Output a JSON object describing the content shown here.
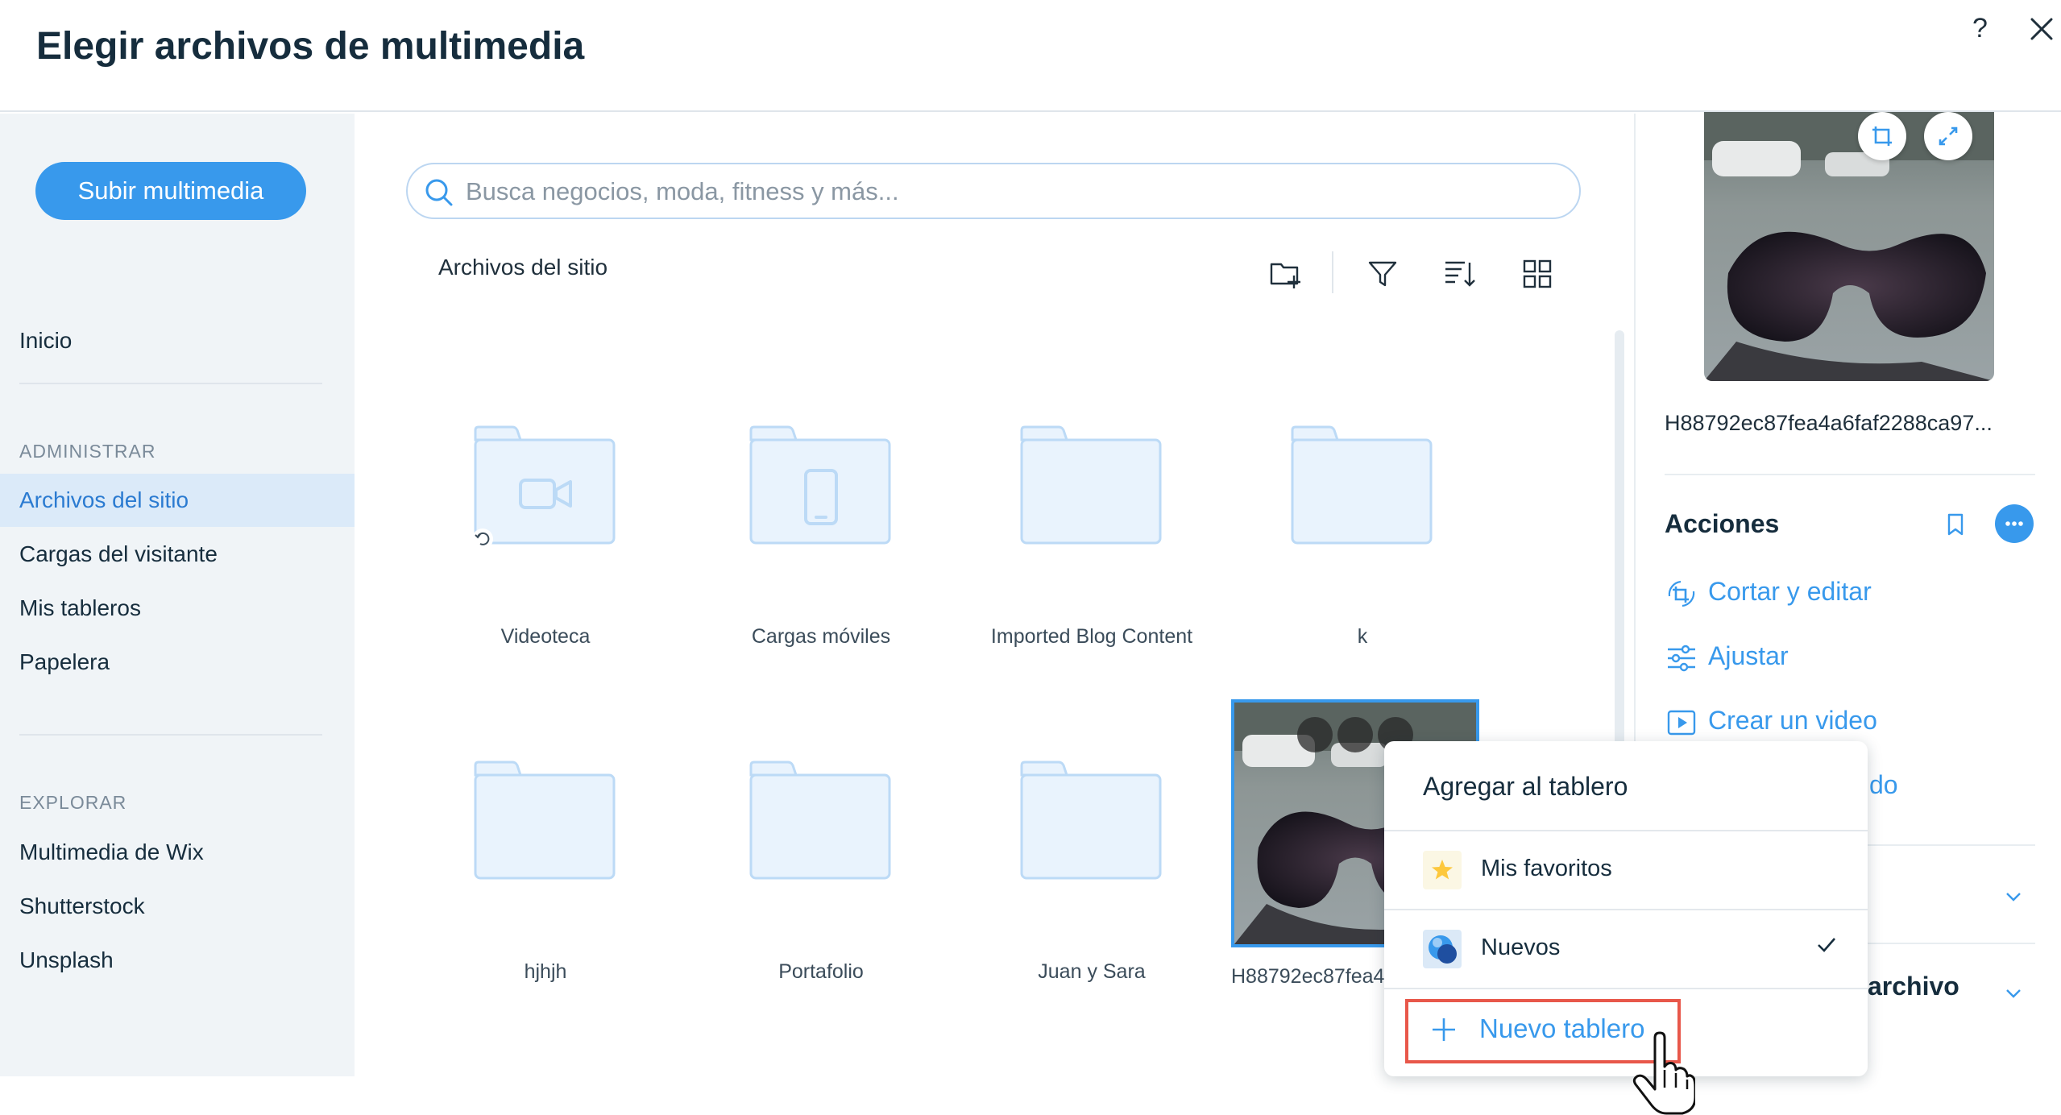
{
  "header": {
    "title": "Elegir archivos de multimedia",
    "help_label": "?",
    "close_icon": "close-icon"
  },
  "sidebar": {
    "upload_label": "Subir multimedia",
    "home_label": "Inicio",
    "section_manage": "ADMINISTRAR",
    "manage_items": [
      "Archivos del sitio",
      "Cargas del visitante",
      "Mis tableros",
      "Papelera"
    ],
    "active_item": "Archivos del sitio",
    "section_explore": "EXPLORAR",
    "explore_items": [
      "Multimedia de Wix",
      "Shutterstock",
      "Unsplash"
    ]
  },
  "main": {
    "search_placeholder": "Busca negocios, moda, fitness y más...",
    "breadcrumb": "Archivos del sitio",
    "toolbar_icons": [
      "new-folder-icon",
      "filter-icon",
      "sort-icon",
      "grid-view-icon"
    ],
    "folders": [
      {
        "label": "Videoteca",
        "icon": "video-camera-icon"
      },
      {
        "label": "Cargas móviles",
        "icon": "mobile-phone-icon"
      },
      {
        "label": "Imported Blog Content",
        "icon": ""
      },
      {
        "label": "k",
        "icon": ""
      },
      {
        "label": "hjhjh",
        "icon": ""
      },
      {
        "label": "Portafolio",
        "icon": ""
      },
      {
        "label": "Juan y Sara",
        "icon": ""
      }
    ],
    "selected_file_label": "H88792ec87fea4"
  },
  "right_panel": {
    "file_name": "H88792ec87fea4a6faf2288ca97...",
    "actions_title": "Acciones",
    "actions": [
      {
        "label": "Cortar y editar",
        "icon": "crop-rotate-icon"
      },
      {
        "label": "Ajustar",
        "icon": "sliders-icon"
      },
      {
        "label": "Crear un video",
        "icon": "video-play-icon"
      },
      {
        "label": "do",
        "icon": ""
      }
    ],
    "file_section_label": "archivo"
  },
  "dropdown": {
    "title": "Agregar al tablero",
    "items": [
      {
        "label": "Mis favoritos",
        "icon": "star-icon",
        "checked": false
      },
      {
        "label": "Nuevos",
        "icon": "board-thumbnail-icon",
        "checked": true
      }
    ],
    "new_board_label": "Nuevo tablero"
  },
  "colors": {
    "accent": "#3899ec",
    "sidebar_bg": "#f0f4f7",
    "active_bg": "#dbeaf9",
    "folder_fill": "#e9f3fd",
    "folder_stroke": "#bcdaf6",
    "highlight_border": "#e8574a"
  }
}
